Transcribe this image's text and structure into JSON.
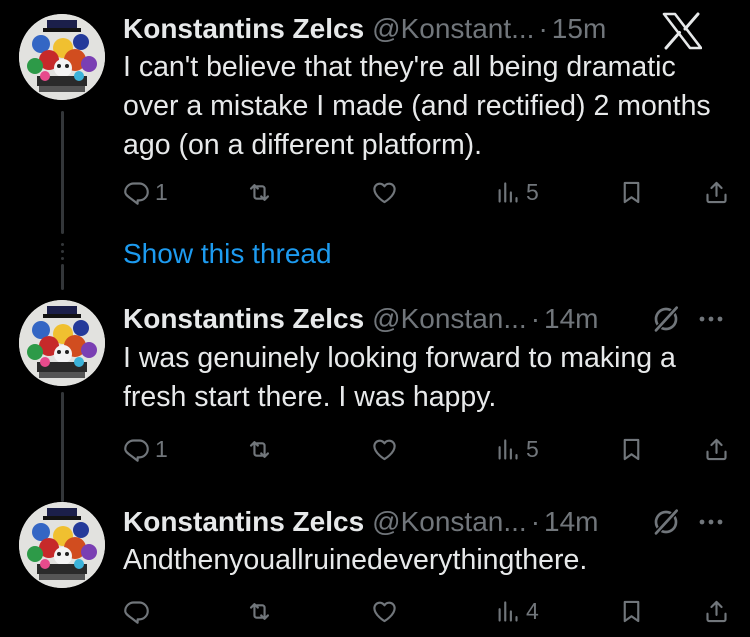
{
  "tweets": [
    {
      "name": "Konstantins Zelcs",
      "handle": "@Konstant...",
      "separator": "·",
      "time": "15m",
      "text": "I can't believe that they're all being dramatic over a mistake I made (and rectified) 2 months ago (on a different platform).",
      "replies": "1",
      "retweets": "",
      "likes": "",
      "views": "5"
    },
    {
      "name": "Konstantins Zelcs",
      "handle": "@Konstan...",
      "separator": "·",
      "time": "14m",
      "text": "I was genuinely looking forward to making a fresh start there. I was happy.",
      "replies": "1",
      "retweets": "",
      "likes": "",
      "views": "5"
    },
    {
      "name": "Konstantins Zelcs",
      "handle": "@Konstan...",
      "separator": "·",
      "time": "14m",
      "text": "Andthenyouallruinedeverythingthere.",
      "replies": "",
      "retweets": "",
      "likes": "",
      "views": "4"
    }
  ],
  "show_thread": "Show this thread",
  "colors": {
    "background": "#000000",
    "text": "#e7e9ea",
    "muted": "#71767b",
    "link": "#1d9bf0"
  },
  "icons": [
    "x-logo-icon",
    "grok-icon",
    "more-icon",
    "reply-icon",
    "retweet-icon",
    "like-icon",
    "views-icon",
    "bookmark-icon",
    "share-icon"
  ]
}
